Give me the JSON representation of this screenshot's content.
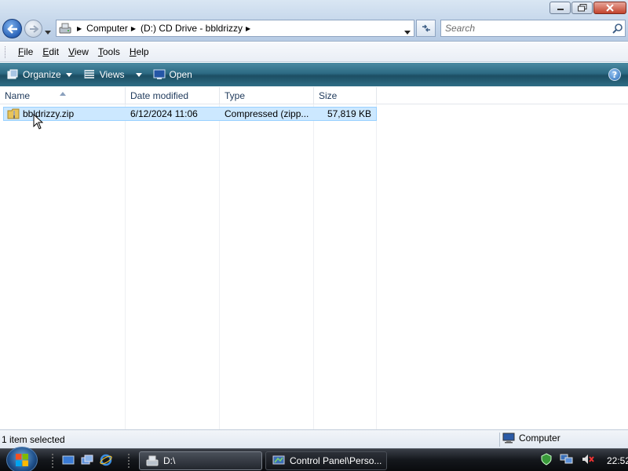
{
  "window": {
    "controls": [
      "minimize-icon",
      "maximize-icon",
      "close-icon"
    ]
  },
  "address_bar": {
    "crumbs": [
      "Computer",
      "(D:) CD Drive - bbldrizzy"
    ]
  },
  "search": {
    "placeholder": "Search"
  },
  "menu": {
    "items": [
      {
        "label_first": "F",
        "label_rest": "ile"
      },
      {
        "label_first": "E",
        "label_rest": "dit"
      },
      {
        "label_first": "V",
        "label_rest": "iew"
      },
      {
        "label_first": "T",
        "label_rest": "ools"
      },
      {
        "label_first": "H",
        "label_rest": "elp"
      }
    ]
  },
  "commands": {
    "organize": "Organize",
    "views": "Views",
    "open": "Open",
    "help": "?"
  },
  "columns": {
    "name": "Name",
    "date": "Date modified",
    "type": "Type",
    "size": "Size"
  },
  "files": [
    {
      "name": "bbldrizzy.zip",
      "date": "6/12/2024 11:06",
      "type": "Compressed (zipp...",
      "size": "57,819 KB",
      "selected": true
    }
  ],
  "status": {
    "selection": "1 item selected",
    "location": "Computer"
  },
  "taskbar": {
    "tasks": [
      {
        "label": "D:\\",
        "active": true
      },
      {
        "label": "Control Panel\\Perso...",
        "active": false
      }
    ],
    "clock": "22:52"
  },
  "colors": {
    "command_bar": "#2c6a83",
    "selection_fill": "#cce8ff",
    "selection_border": "#99d1ff",
    "taskbar": "#14171c"
  }
}
